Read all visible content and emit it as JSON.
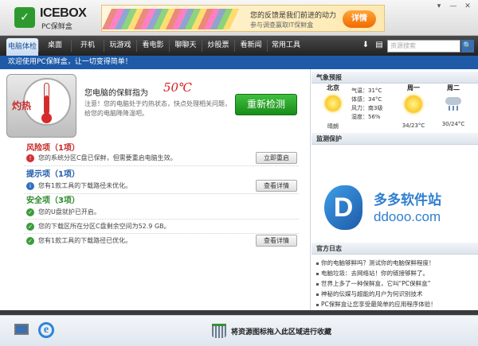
{
  "app": {
    "brand": "ICEBOX",
    "subtitle": "PC保鲜盒",
    "logo_glyph": "✓"
  },
  "banner": {
    "line1": "您的反馈是我们前进的动力",
    "line2": "参与调查赢取IT保鲜盒",
    "button": "详情"
  },
  "window_controls": [
    "▾",
    "—",
    "✕"
  ],
  "nav": {
    "tabs": [
      "电脑体检",
      "桌面",
      "开机",
      "玩游戏",
      "看电影",
      "聊聊天",
      "炒股票",
      "看新闻",
      "常用工具"
    ],
    "active_index": 0,
    "search_placeholder": "资源搜索",
    "search_glyph": "🔍",
    "download_glyph": "⬇",
    "folder_glyph": "▤"
  },
  "welcome": "欢迎使用PC保鲜盒，让一切变得简单！",
  "health": {
    "badge": "灼热",
    "title": "您电脑的保鲜指为",
    "value": "50℃",
    "description": "注意！您的电脑处于灼热状态，快点处理相关问题，给您的电脑降降温吧。",
    "recheck": "重新检测",
    "level_percent": 50
  },
  "sections": {
    "risk": {
      "title": "风险项（1项）",
      "items": [
        {
          "text": "您的系统分区C盘已保鲜，但需要重启电脑生效。",
          "button": "立即重启"
        }
      ]
    },
    "tip": {
      "title": "提示项（1项）",
      "items": [
        {
          "text": "您有1款工具的下载路径未优化。",
          "button": "查看详情"
        }
      ]
    },
    "safe": {
      "title": "安全项（3项）",
      "items": [
        {
          "text": "您的U盘就护已开启。",
          "button": ""
        },
        {
          "text": "您的下载区所在分区C盘剩余空间为52.9 GB。",
          "button": ""
        },
        {
          "text": "您有1款工具的下载路径已优化。",
          "button": "查看详情"
        }
      ]
    }
  },
  "weather": {
    "header": "气象预报",
    "today": {
      "city": "北京",
      "condition": "晴朗",
      "stats": [
        "气温：31°C",
        "体感：34°C",
        "风力：南3级",
        "湿度：56%"
      ]
    },
    "forecast": [
      {
        "day": "周一",
        "temp": "34/23°C",
        "icon": "sun-icon"
      },
      {
        "day": "周二",
        "temp": "30/24°C",
        "icon": "rain-icon"
      }
    ]
  },
  "monitor": {
    "header": "监测保护"
  },
  "watermark": {
    "logo_letter": "D",
    "line1": "多多软件站",
    "line2": "ddooo.com"
  },
  "log": {
    "header": "官方日志",
    "items": [
      "你的电脑够鲜吗？测试你的电脑保鲜程度！",
      "电脑垃圾：去网络站！你的链接够鲜了。",
      "世界上多了一种保鲜盒，它叫“PC保鲜盒”",
      "神秘的伝媒与超能的月户为何识别技术",
      "PC保鲜盒让您享受最简单的应用程序体验！"
    ]
  },
  "bottom": {
    "drop_text": "将资源图标拖入此区域进行收藏",
    "ie_glyph": "e"
  },
  "colors": {
    "accent_blue": "#1e5aa8",
    "risk_red": "#c62828",
    "safe_green": "#2b8a2b",
    "temp_red": "#d62020"
  }
}
